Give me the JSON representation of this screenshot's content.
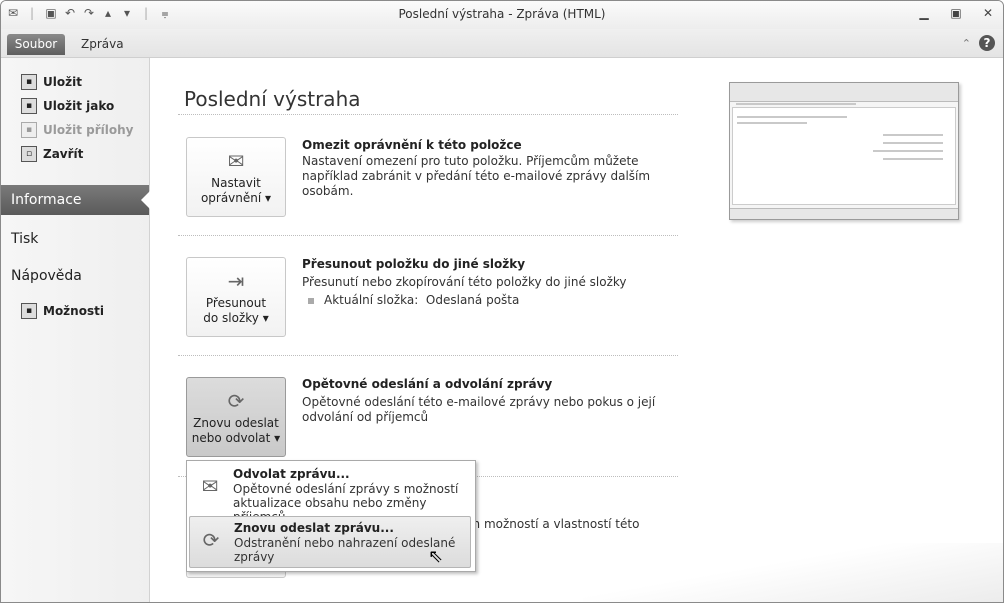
{
  "window": {
    "title": "Poslední výstraha - Zpráva (HTML)"
  },
  "qat": {
    "icons": [
      "envelope-icon",
      "save-icon",
      "undo-icon",
      "redo-icon",
      "up-icon",
      "down-icon",
      "customize-icon"
    ]
  },
  "ribbon": {
    "tabs": [
      {
        "label": "Soubor"
      },
      {
        "label": "Zpráva"
      }
    ]
  },
  "nav": {
    "commands": [
      {
        "label": "Uložit"
      },
      {
        "label": "Uložit jako"
      },
      {
        "label": "Uložit přílohy"
      },
      {
        "label": "Zavřít"
      }
    ],
    "sections": [
      {
        "label": "Informace"
      },
      {
        "label": "Tisk"
      },
      {
        "label": "Nápověda"
      }
    ],
    "options_label": "Možnosti"
  },
  "main": {
    "page_title": "Poslední výstraha",
    "permissions": {
      "button_label_1": "Nastavit",
      "button_label_2": "oprávnění ▾",
      "title": "Omezit oprávnění k této položce",
      "desc": "Nastavení omezení pro tuto položku. Příjemcům můžete například zabránit v předání této e-mailové zprávy dalším osobám."
    },
    "move": {
      "button_label_1": "Přesunout",
      "button_label_2": "do složky ▾",
      "title": "Přesunout položku do jiné složky",
      "desc": "Přesunutí nebo zkopírování této položky do jiné složky",
      "folder_label": "Aktuální složka:",
      "folder_value": "Odeslaná pošta"
    },
    "resend": {
      "button_label_1": "Znovu odeslat",
      "button_label_2": "nebo odvolat ▾",
      "title": "Opětovné odeslání a odvolání zprávy",
      "desc": "Opětovné odeslání této e-mailové zprávy nebo pokus o její odvolání od příjemců"
    },
    "properties_partial_desc": "cích možností a vlastností této"
  },
  "menu": {
    "items": [
      {
        "title": "Odvolat zprávu...",
        "desc": "Opětovné odeslání zprávy s možností aktualizace obsahu nebo změny příjemců"
      },
      {
        "title": "Znovu odeslat zprávu...",
        "desc": "Odstranění nebo nahrazení odeslané zprávy"
      }
    ]
  }
}
